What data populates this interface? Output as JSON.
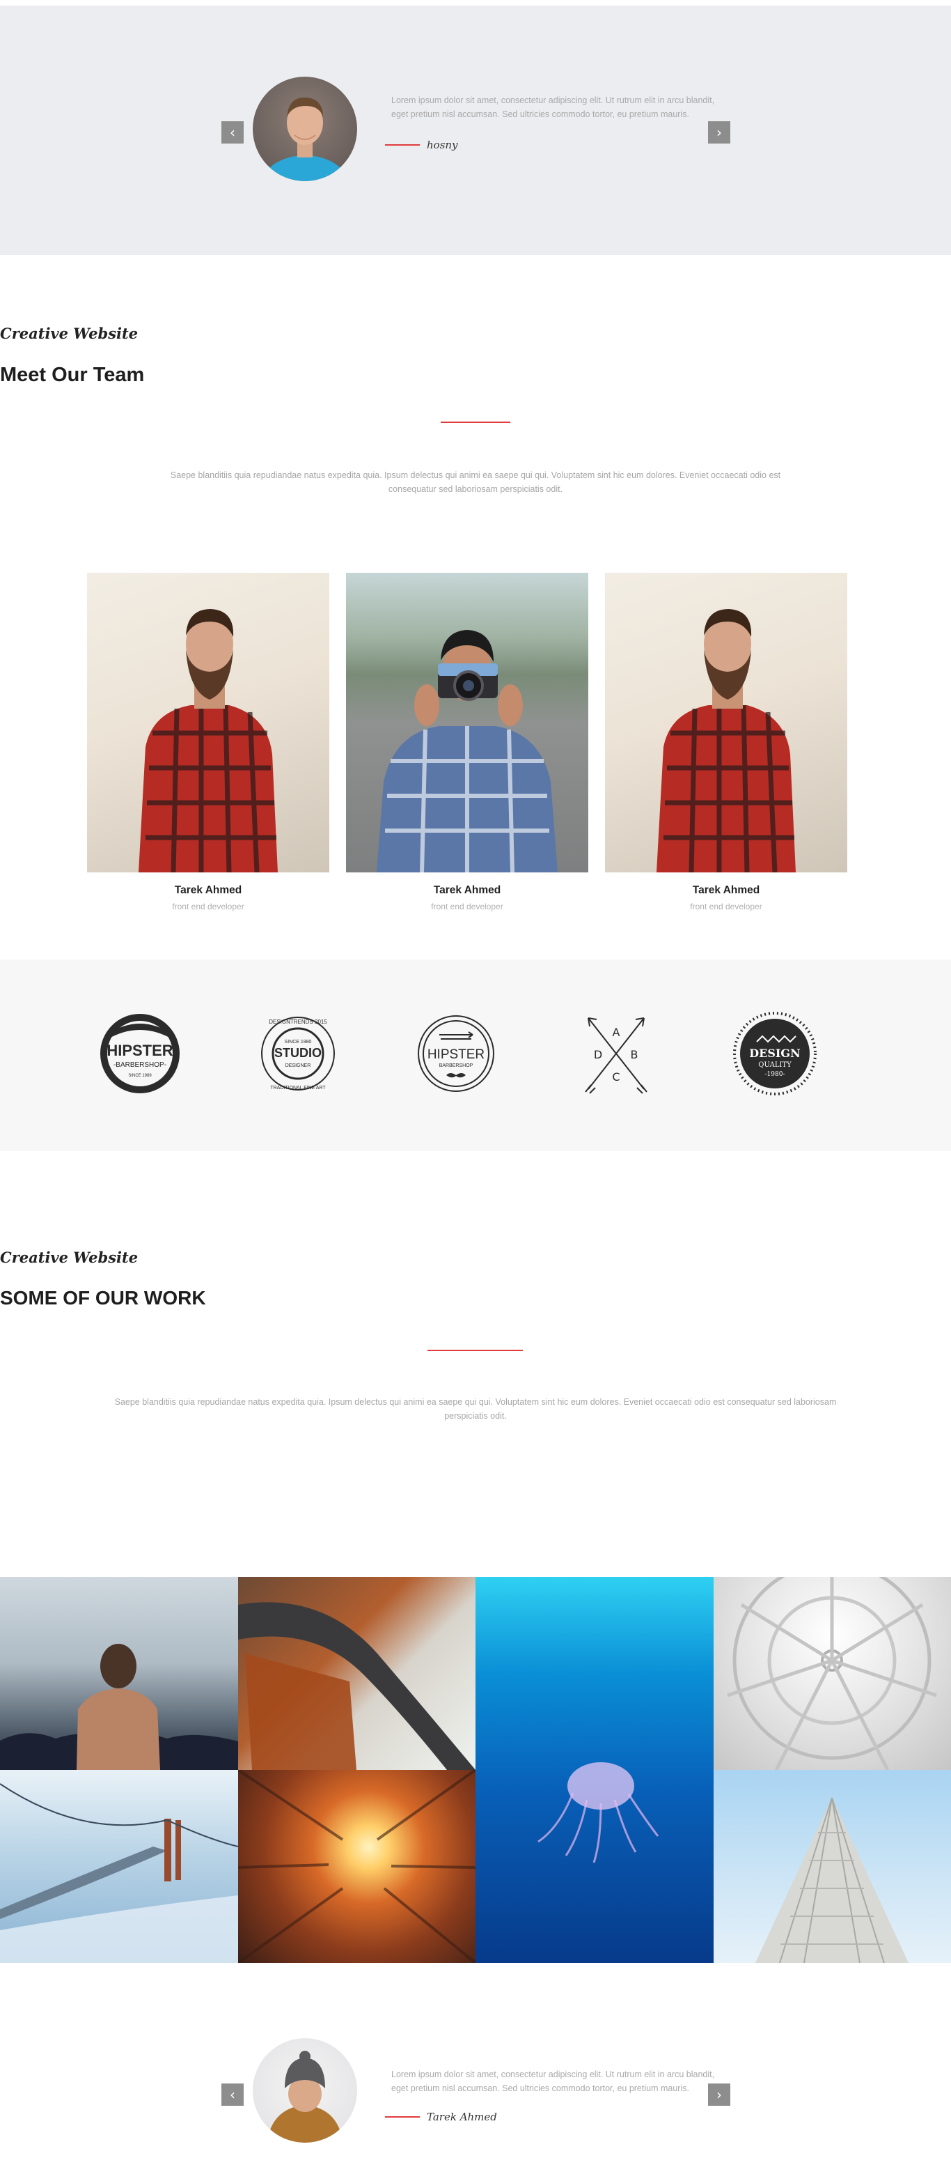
{
  "testimonial_top": {
    "prev_arrow": "‹",
    "next_arrow": "›",
    "quote": "Lorem ipsum dolor sit amet, consectetur adipiscing elit. Ut rutrum elit in arcu blandit, eget pretium nisl accumsan. Sed ultricies commodo tortor, eu pretium mauris.",
    "author": "hosny"
  },
  "team": {
    "script_title": "Creative Website",
    "title": "Meet Our Team",
    "description": "Saepe blanditiis quia repudiandae natus expedita quia. Ipsum delectus qui animi ea saepe qui qui. Voluptatem sint hic eum dolores. Eveniet occaecati odio est consequatur sed laboriosam perspiciatis odit.",
    "members": [
      {
        "name": "Tarek Ahmed",
        "role": "front end developer"
      },
      {
        "name": "Tarek Ahmed",
        "role": "front end developer"
      },
      {
        "name": "Tarek Ahmed",
        "role": "front end developer"
      }
    ]
  },
  "brands": {
    "logo1": {
      "main": "HIPSTER",
      "sub": "-BARBERSHOP-",
      "small": "SINCE 1989"
    },
    "logo2": {
      "top": "DESIGNTRENDS 2015",
      "since": "SINCE 1980",
      "main": "STUDIO",
      "sub": "DESIGNER",
      "bottom": "TRADITIONAL FINE ART"
    },
    "logo3": {
      "main": "HIPSTER",
      "sub": "BARBERSHOP"
    },
    "logo4": {
      "a": "A",
      "b": "B",
      "c": "C",
      "d": "D"
    },
    "logo5": {
      "main": "DESIGN",
      "sub": "QUALITY",
      "year": "-1980-"
    }
  },
  "work": {
    "script_title": "Creative Website",
    "title": "SOME OF OUR WORK",
    "description": "Saepe blanditiis quia repudiandae natus expedita quia. Ipsum delectus qui animi ea saepe qui qui. Voluptatem sint hic eum dolores. Eveniet occaecati odio est consequatur sed laboriosam perspiciatis odit."
  },
  "testimonial_bottom": {
    "prev_arrow": "‹",
    "next_arrow": "›",
    "quote": "Lorem ipsum dolor sit amet, consectetur adipiscing elit. Ut rutrum elit in arcu blandit, eget pretium nisl accumsan. Sed ultricies commodo tortor, eu pretium mauris.",
    "author": "Tarek Ahmed"
  },
  "colors": {
    "accent": "#e23b3b",
    "testimonial_bg": "#ecedf0",
    "brands_bg": "#f7f7f7",
    "muted_text": "#a6a6a6"
  }
}
